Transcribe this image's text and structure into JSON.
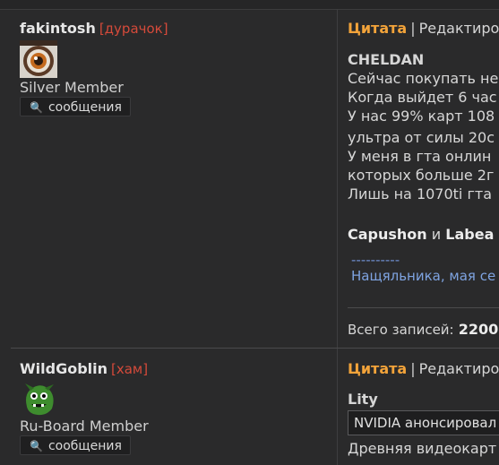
{
  "posts": [
    {
      "username": "fakintosh",
      "tag": "[дурачок]",
      "rank": "Silver Member",
      "messages_label": "сообщения",
      "actions": {
        "quote": "Цитата",
        "edit": "Редактиров"
      },
      "quoted_author": "CHELDAN",
      "lines": [
        "Сейчас покупать не",
        "Когда выйдет 6 час",
        "У нас 99% карт 108",
        "ультра от силы 20с",
        "У меня в гта онлин",
        "которых больше 2г",
        "Лишь на 1070ti гта"
      ],
      "mentions": {
        "a": "Capushon",
        "and": "и",
        "b": "Labea"
      },
      "signature_dashes": "----------",
      "signature_text": "Нащяльника, мая се",
      "total_label": "Всего записей:",
      "total_value": "2200"
    },
    {
      "username": "WildGoblin",
      "tag": "[хам]",
      "rank": "Ru-Board Member",
      "messages_label": "сообщения",
      "actions": {
        "quote": "Цитата",
        "edit": "Редактиров"
      },
      "quoted_author": "Lity",
      "quote_box_text": "NVIDIA анонсировал",
      "after_quote": "Древняя видеокарт"
    }
  ]
}
